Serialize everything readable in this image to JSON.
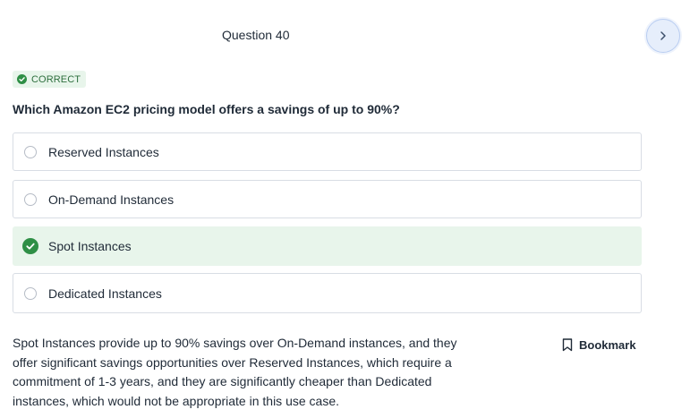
{
  "header": {
    "question_number": "Question 40",
    "next_icon": "chevron-right-icon"
  },
  "status": {
    "label": "CORRECT",
    "icon": "check-circle-icon",
    "color": "#2f8f46"
  },
  "question": {
    "text": "Which Amazon EC2 pricing model offers a savings of up to 90%?"
  },
  "options": [
    {
      "label": "Reserved Instances",
      "state": "unselected"
    },
    {
      "label": "On-Demand Instances",
      "state": "unselected"
    },
    {
      "label": "Spot Instances",
      "state": "correct"
    },
    {
      "label": "Dedicated Instances",
      "state": "unselected"
    }
  ],
  "explanation": {
    "text": "Spot Instances provide up to 90% savings over On-Demand instances, and they offer significant savings opportunities over Reserved Instances, which require a commitment of 1-3 years, and they are significantly cheaper than Dedicated instances, which would not be appropriate in this use case."
  },
  "bookmark": {
    "label": "Bookmark",
    "icon": "bookmark-icon"
  },
  "colors": {
    "accent_blue": "#b9cdf1",
    "correct_bg": "#e8f5eb",
    "correct_green": "#2f8f46",
    "text": "#1f2a37"
  }
}
